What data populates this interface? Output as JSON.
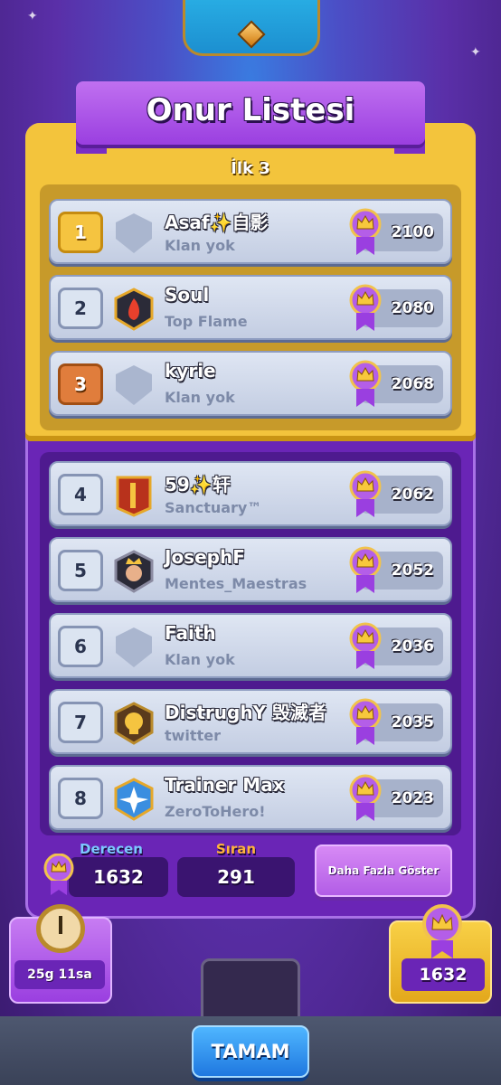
{
  "title": "Onur Listesi",
  "top_section_label": "İlk 3",
  "players": [
    {
      "rank": "1",
      "name": "Asaf✨自影",
      "clan": "Klan yok",
      "score": "2100",
      "rank_style": "gold",
      "badge": "empty-shield-icon"
    },
    {
      "rank": "2",
      "name": "Soul",
      "clan": "Top Flame",
      "score": "2080",
      "rank_style": "silver",
      "badge": "flame-badge-icon"
    },
    {
      "rank": "3",
      "name": "kyrie",
      "clan": "Klan yok",
      "score": "2068",
      "rank_style": "bronze",
      "badge": "empty-shield-icon"
    },
    {
      "rank": "4",
      "name": "59✨轩",
      "clan": "Sanctuary™",
      "score": "2062",
      "rank_style": "silver",
      "badge": "bamboo-badge-icon"
    },
    {
      "rank": "5",
      "name": "JosephF",
      "clan": "Mentes_Maestras",
      "score": "2052",
      "rank_style": "silver",
      "badge": "king-badge-icon"
    },
    {
      "rank": "6",
      "name": "Faith",
      "clan": "Klan yok",
      "score": "2036",
      "rank_style": "silver",
      "badge": "empty-shield-icon"
    },
    {
      "rank": "7",
      "name": "DistrughY 毁滅者",
      "clan": "twitter",
      "score": "2035",
      "rank_style": "silver",
      "badge": "skull-badge-icon"
    },
    {
      "rank": "8",
      "name": "Trainer Max",
      "clan": "ZeroToHero!",
      "score": "2023",
      "rank_style": "silver",
      "badge": "star-badge-icon"
    }
  ],
  "stats": {
    "rating_label": "Derecen",
    "rating_value": "1632",
    "position_label": "Sıran",
    "position_value": "291",
    "more_button": "Daha Fazla Göster"
  },
  "timer": {
    "value": "25g 11sa"
  },
  "rating_card": {
    "value": "1632"
  },
  "ok_button": "TAMAM",
  "colors": {
    "gold": "#f3c43c",
    "purple": "#6a25b6",
    "blue_button": "#1f78e0"
  }
}
